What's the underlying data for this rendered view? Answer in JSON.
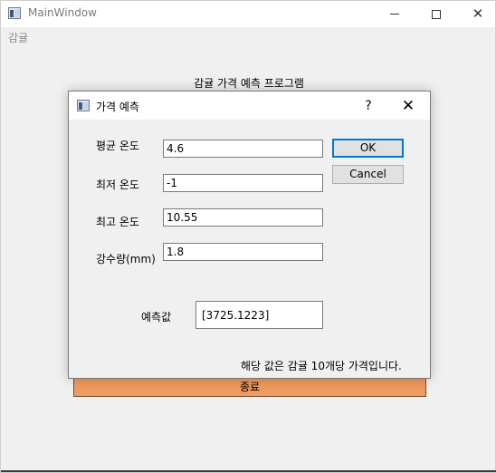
{
  "main_window": {
    "title": "MainWindow",
    "menu": [
      "감귤"
    ],
    "program_title": "감귤 가격 예측 프로그램",
    "exit_label": "종료",
    "controls": {
      "minimize": "—",
      "maximize": "☐",
      "close": "✕"
    }
  },
  "dialog": {
    "title": "가격 예측",
    "help": "?",
    "close": "✕",
    "fields": {
      "avg_temp": {
        "label": "평균 온도",
        "value": "4.6"
      },
      "min_temp": {
        "label": "최저 온도",
        "value": "-1"
      },
      "max_temp": {
        "label": "최고 온도",
        "value": "10.55"
      },
      "rainfall": {
        "label": "강수량(mm)",
        "value": "1.8"
      }
    },
    "prediction": {
      "label": "예측값",
      "value": "[3725.1223]"
    },
    "ok_label": "OK",
    "cancel_label": "Cancel",
    "note": "해당 값은 감귤 10개당 가격입니다."
  },
  "colors": {
    "exit_button": "#ef9a5e",
    "ok_focus": "#0078d7"
  },
  "icons": [
    "app-icon",
    "help-icon",
    "close-icon"
  ]
}
